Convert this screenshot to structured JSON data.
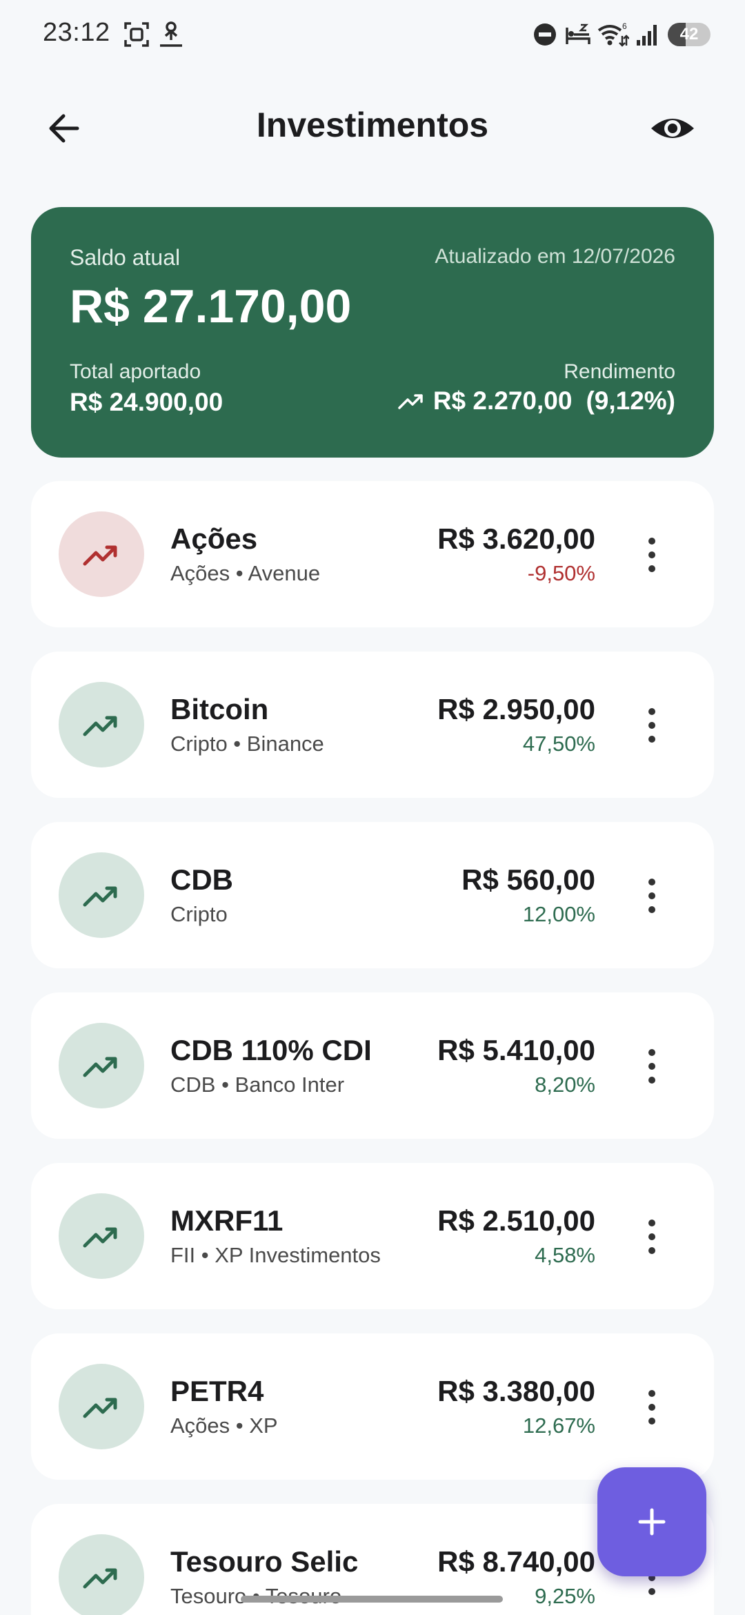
{
  "status_bar": {
    "time": "23:12",
    "battery": "42",
    "battery_level": 0.42,
    "icons": [
      "screenshot-icon",
      "upload-icon",
      "do-not-disturb-icon",
      "sleep-icon",
      "wifi-icon",
      "signal-icon",
      "battery-icon"
    ]
  },
  "app_bar": {
    "title": "Investimentos",
    "back_icon": "arrow-back-icon",
    "visibility_icon": "eye-icon"
  },
  "summary": {
    "label": "Saldo atual",
    "updated": "Atualizado em 12/07/2026",
    "balance": "R$ 27.170,00",
    "total_label": "Total aportado",
    "total_value": "R$ 24.900,00",
    "yield_label": "Rendimento",
    "yield_value": "R$ 2.270,00",
    "yield_pct": "(9,12%)"
  },
  "colors": {
    "card_green": "#2d6b4f",
    "positive": "#2d6b4f",
    "negative": "#b03030",
    "fab": "#6e5ee0"
  },
  "investments": [
    {
      "name": "Ações",
      "subtitle": "Ações • Avenue",
      "value": "R$ 3.620,00",
      "pct": "-9,50%",
      "trend": "negative"
    },
    {
      "name": "Bitcoin",
      "subtitle": "Cripto • Binance",
      "value": "R$ 2.950,00",
      "pct": "47,50%",
      "trend": "positive"
    },
    {
      "name": "CDB",
      "subtitle": "Cripto",
      "value": "R$ 560,00",
      "pct": "12,00%",
      "trend": "positive"
    },
    {
      "name": "CDB 110% CDI",
      "subtitle": "CDB • Banco Inter",
      "value": "R$ 5.410,00",
      "pct": "8,20%",
      "trend": "positive"
    },
    {
      "name": "MXRF11",
      "subtitle": "FII • XP Investimentos",
      "value": "R$ 2.510,00",
      "pct": "4,58%",
      "trend": "positive"
    },
    {
      "name": "PETR4",
      "subtitle": "Ações • XP",
      "value": "R$ 3.380,00",
      "pct": "12,67%",
      "trend": "positive"
    },
    {
      "name": "Tesouro Selic",
      "subtitle": "Tesouro • Tesouro",
      "value": "R$ 8.740,00",
      "pct": "9,25%",
      "trend": "positive"
    }
  ],
  "fab": {
    "icon": "plus-icon"
  }
}
